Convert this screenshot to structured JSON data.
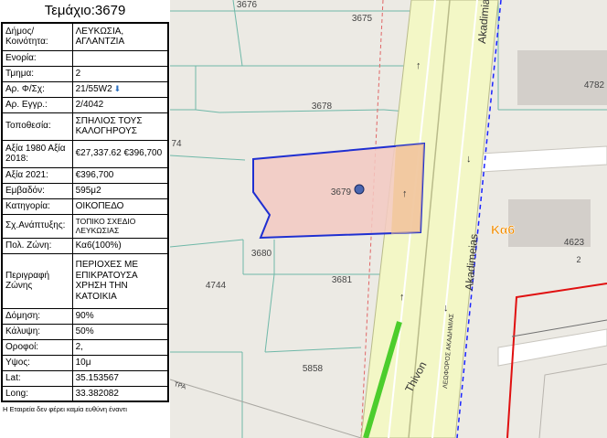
{
  "panel": {
    "title": "Τεμάχιο:3679",
    "rows": [
      {
        "key": "Δήμος/ Κοινότητα:",
        "value": "ΛΕΥΚΩΣΙΑ, ΑΓΛΑΝΤΖΙΑ"
      },
      {
        "key": "Ενορία:",
        "value": ""
      },
      {
        "key": "Τμημα:",
        "value": "2"
      },
      {
        "key": "Αρ. Φ/Σχ:",
        "value": "21/55W2"
      },
      {
        "key": "Αρ. Εγγρ.:",
        "value": "2/4042"
      },
      {
        "key": "Τοποθεσία:",
        "value": "ΣΠΗΛΙΟΣ ΤΟΥΣ ΚΑΛΟΓΗΡΟΥΣ"
      },
      {
        "key": "Αξία 1980 Αξία 2018:",
        "value": "€27,337.62 €396,700"
      },
      {
        "key": "Αξία 2021:",
        "value": "€396,700"
      },
      {
        "key": "Εμβαδόν:",
        "value": "595μ2"
      },
      {
        "key": "Κατηγορία:",
        "value": "ΟΙΚΟΠΕΔΟ"
      },
      {
        "key": "Σχ.Ανάπτυξης:",
        "value": "ΤΟΠΙΚΟ ΣΧΕΔΙΟ ΛΕΥΚΩΣΙΑΣ"
      },
      {
        "key": "Πολ. Ζώνη:",
        "value": "Κα6(100%)"
      },
      {
        "key": "Περιγραφή Ζώνης",
        "value": "ΠΕΡΙΟΧΕΣ ΜΕ ΕΠΙΚΡΑΤΟΥΣΑ ΧΡΗΣΗ ΤΗΝ ΚΑΤΟΙΚΙΑ"
      },
      {
        "key": "Δόμηση:",
        "value": "90%"
      },
      {
        "key": "Κάλυψη:",
        "value": "50%"
      },
      {
        "key": "Οροφοί:",
        "value": "2,"
      },
      {
        "key": "Υψος:",
        "value": "10μ"
      },
      {
        "key": "Lat:",
        "value": "35.153567"
      },
      {
        "key": "Long:",
        "value": "33.382082"
      }
    ],
    "disclaimer": "Η Εταιρεία δεν φέρει καμία ευθύνη έναντι"
  },
  "map": {
    "parcel_labels": {
      "p3676": "3676",
      "p3675": "3675",
      "p3678": "3678",
      "p3679": "3679",
      "p3680": "3680",
      "p3681": "3681",
      "p4744": "4744",
      "p5858": "5858",
      "p4782": "4782",
      "p4623": "4623",
      "p74": "74"
    },
    "building_number": "2",
    "zone_label": "Κα6",
    "street_labels": {
      "akadimias_top": "Akadimias",
      "akadimias_mid": "Akadimeias",
      "akadimias_greek": "ΛΕΩΦΟΡΟΣ ΑΚΑΔΗΜΙΑΣ",
      "thivon": "Thivon",
      "tra": "ΤΡΑ"
    },
    "colors": {
      "parcel_outline": "#1f2fd1",
      "parcel_fill": "#f3c9c2",
      "zone_label": "#f08c00",
      "road_fill": "#f3f7c6",
      "green_line": "#4ccd2c",
      "red_boundary": "#e01010",
      "dashed_blue": "#1a24ff"
    }
  }
}
